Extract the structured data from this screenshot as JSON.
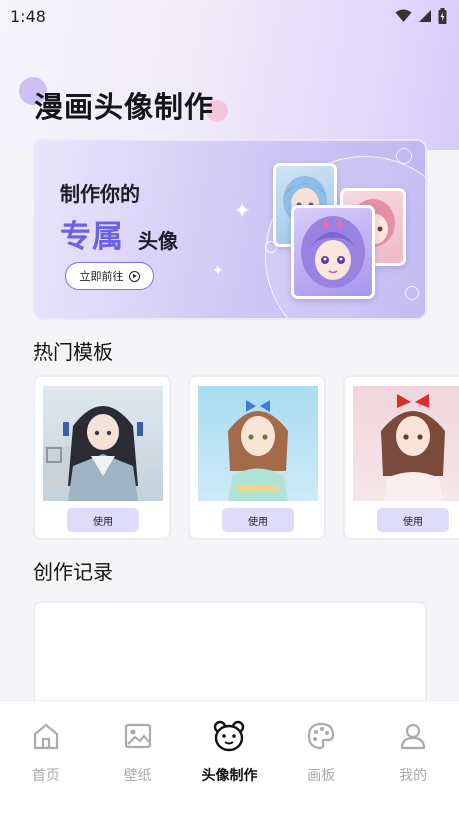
{
  "status_bar": {
    "time": "1:48"
  },
  "header": {
    "title": "漫画头像制作"
  },
  "banner": {
    "line1": "制作你的",
    "line2": "专属",
    "line3": "头像",
    "button_label": "立即前往"
  },
  "hot_templates": {
    "title": "热门模板",
    "items": [
      {
        "button_label": "使用",
        "icon": "hanfu-girl-snow-image"
      },
      {
        "button_label": "使用",
        "icon": "bow-girl-blue-image"
      },
      {
        "button_label": "使用",
        "icon": "red-bow-girl-pink-image"
      }
    ]
  },
  "records": {
    "title": "创作记录"
  },
  "tabbar": {
    "items": [
      {
        "label": "首页",
        "icon": "home-icon",
        "active": false
      },
      {
        "label": "壁纸",
        "icon": "image-icon",
        "active": false
      },
      {
        "label": "头像制作",
        "icon": "bear-icon",
        "active": true
      },
      {
        "label": "画板",
        "icon": "palette-icon",
        "active": false
      },
      {
        "label": "我的",
        "icon": "person-icon",
        "active": false
      }
    ]
  },
  "colors": {
    "accent": "#6c62e6",
    "template_button_bg": "#dedbfb",
    "tab_inactive": "#aaaab0"
  }
}
